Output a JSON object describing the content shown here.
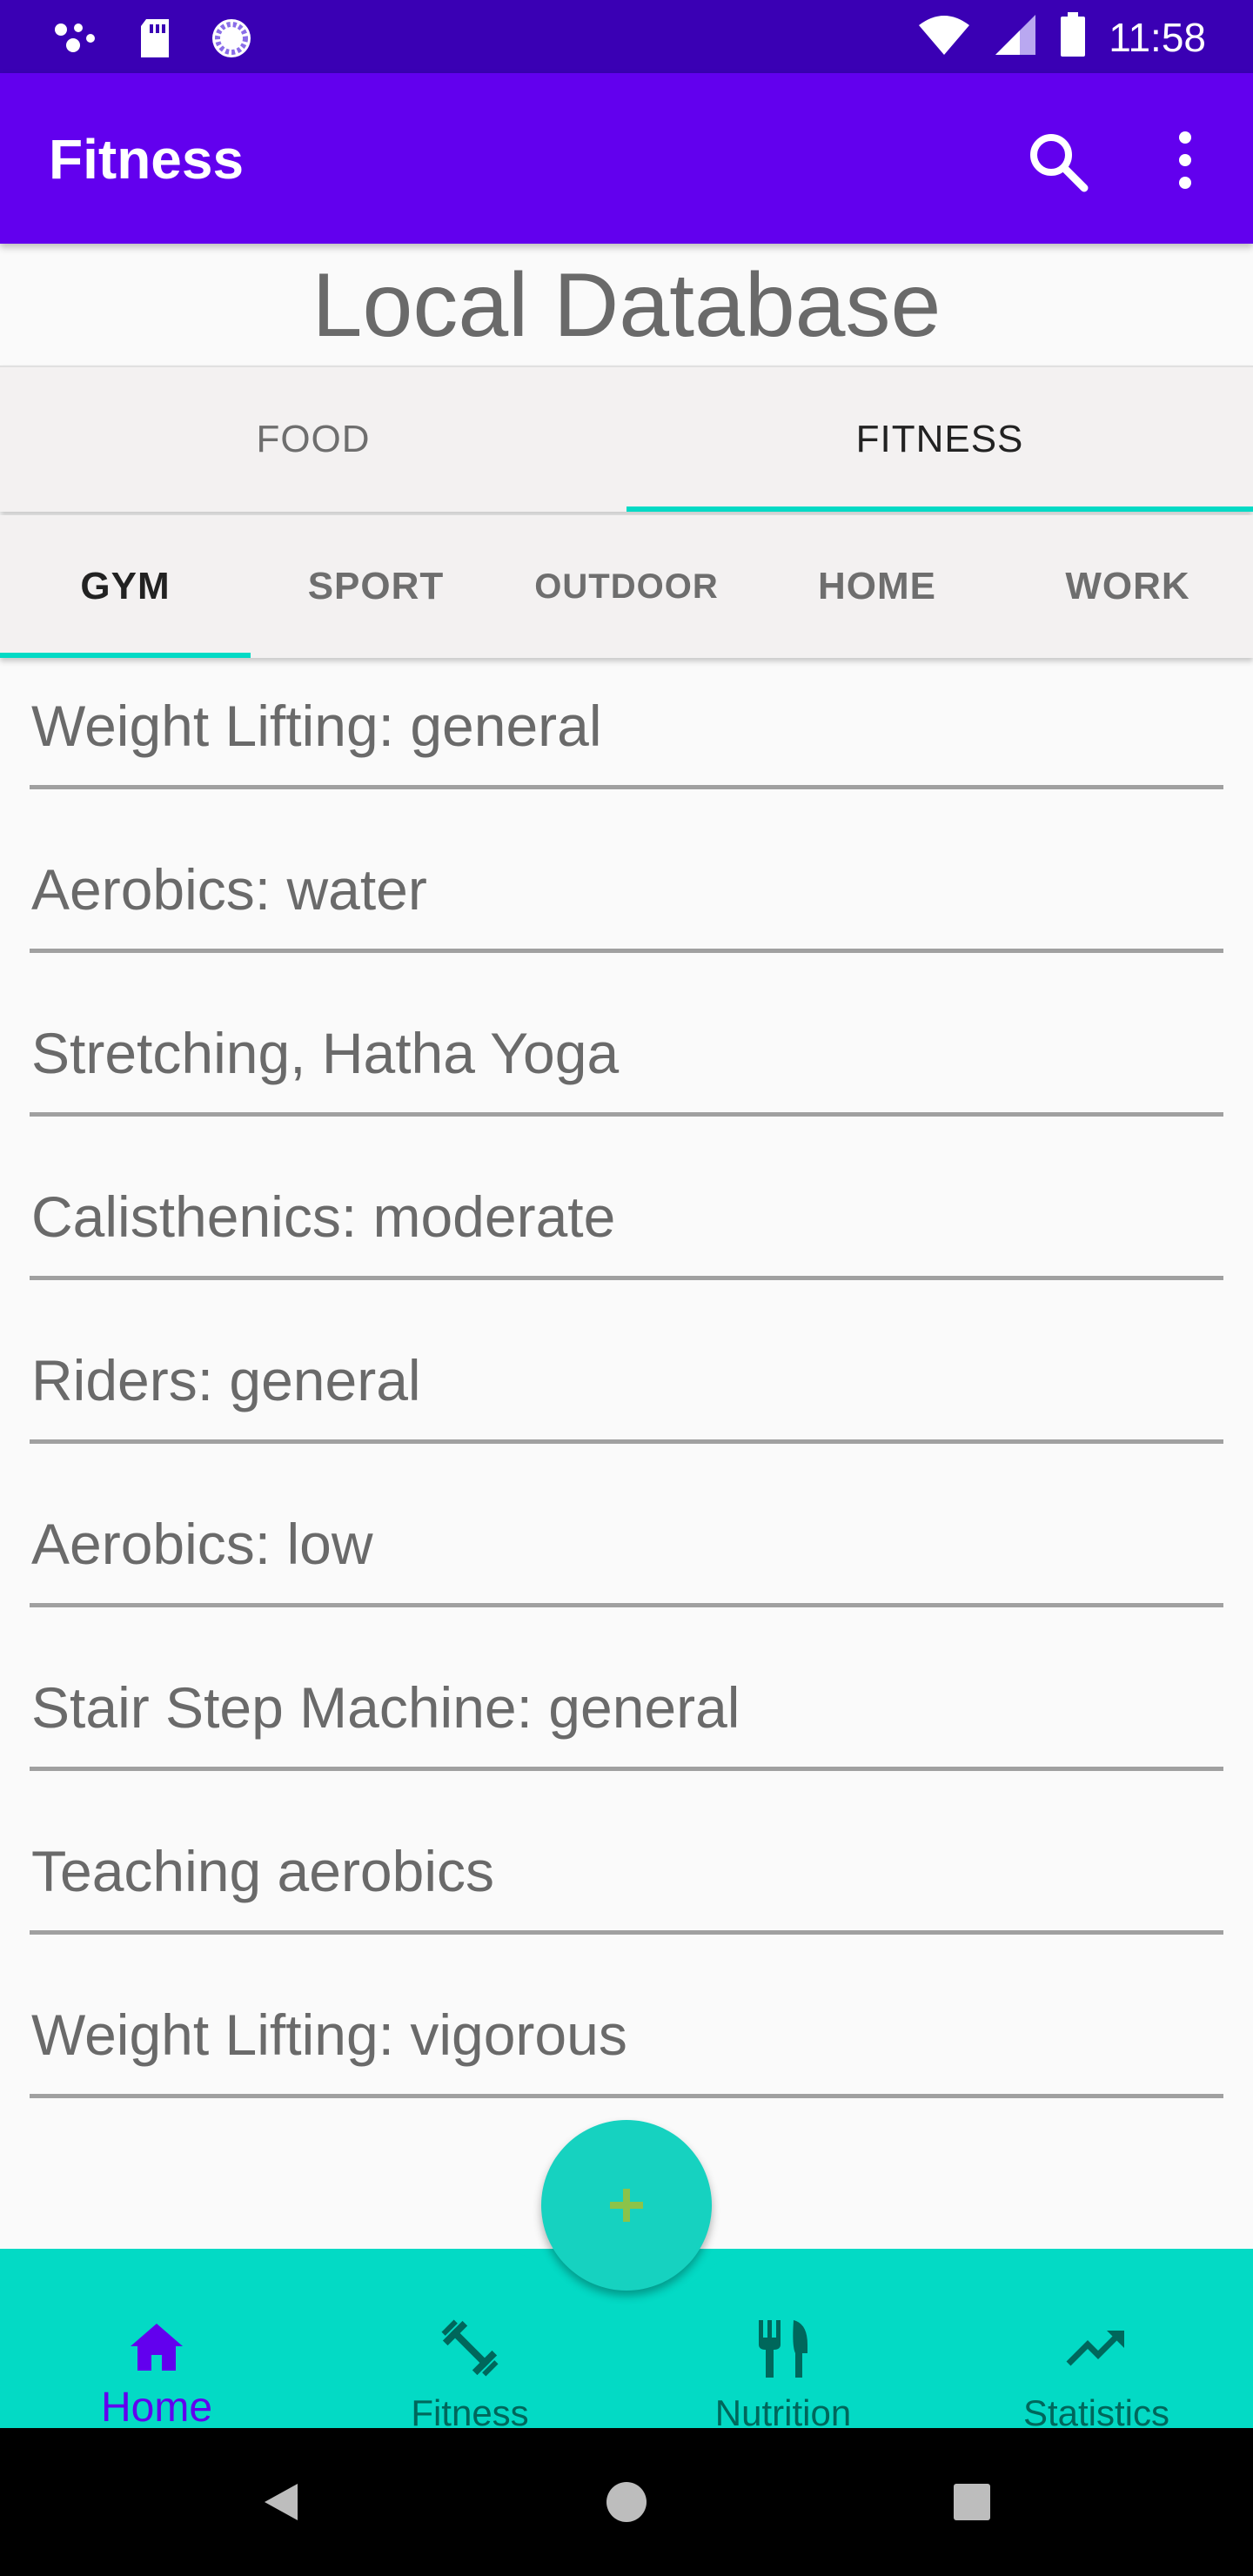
{
  "status_bar": {
    "time": "11:58",
    "left_icons": [
      "notification-dots-icon",
      "sd-card-icon",
      "sync-circle-icon"
    ],
    "right_icons": [
      "wifi-icon",
      "signal-icon",
      "battery-icon"
    ]
  },
  "app_bar": {
    "title": "Fitness",
    "actions": [
      "search-icon",
      "more-vert-icon"
    ]
  },
  "page": {
    "title": "Local Database"
  },
  "main_tabs": [
    {
      "label": "FOOD",
      "active": false
    },
    {
      "label": "FITNESS",
      "active": true
    }
  ],
  "sub_tabs": [
    {
      "label": "GYM",
      "active": true
    },
    {
      "label": "SPORT",
      "active": false
    },
    {
      "label": "OUTDOOR",
      "active": false
    },
    {
      "label": "HOME",
      "active": false
    },
    {
      "label": "WORK",
      "active": false
    }
  ],
  "list_items": [
    "Weight Lifting: general",
    "Aerobics: water",
    "Stretching, Hatha Yoga",
    "Calisthenics: moderate",
    "Riders: general",
    "Aerobics: low",
    "Stair Step Machine: general",
    "Teaching aerobics",
    "Weight Lifting: vigorous"
  ],
  "fab": {
    "icon": "plus-icon"
  },
  "bottom_nav": [
    {
      "label": "Home",
      "icon": "home-icon",
      "active": true
    },
    {
      "label": "Fitness",
      "icon": "dumbbell-icon",
      "active": false
    },
    {
      "label": "Nutrition",
      "icon": "restaurant-icon",
      "active": false
    },
    {
      "label": "Statistics",
      "icon": "trending-up-icon",
      "active": false
    }
  ],
  "colors": {
    "status_bar": "#3a00b4",
    "app_bar": "#6200ee",
    "accent": "#03dac5",
    "active_nav": "#6200ee"
  }
}
